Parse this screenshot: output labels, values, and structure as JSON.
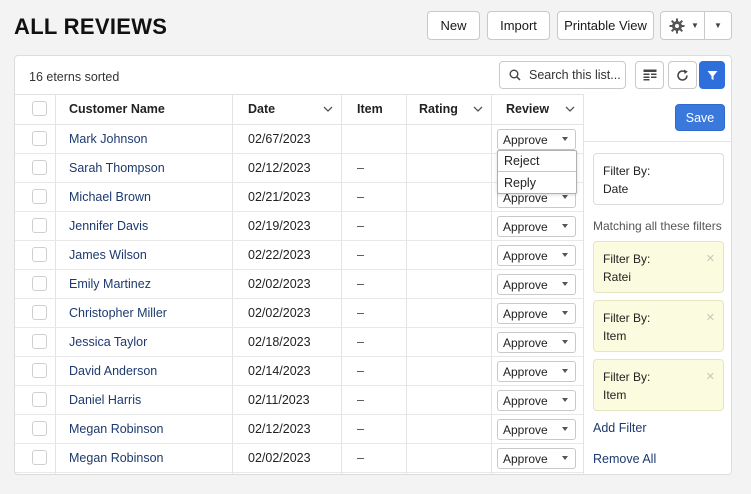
{
  "header": {
    "title": "ALL REVIEWS",
    "buttons": {
      "new": "New",
      "import": "Import",
      "printable": "Printable View"
    }
  },
  "list": {
    "sort_status": "16 eterns sorted",
    "search": {
      "placeholder": "Search this list..."
    },
    "columns": [
      "Customer Name",
      "Date",
      "Item",
      "Rating",
      "Review"
    ],
    "rows": [
      {
        "name": "Mark Johnson",
        "date": "02/67/2023",
        "item": "",
        "rating": "",
        "review": "Approve"
      },
      {
        "name": "Sarah Thompson",
        "date": "02/12/2023",
        "item": "–",
        "rating": "",
        "review": "Approve"
      },
      {
        "name": "Michael Brown",
        "date": "02/21/2023",
        "item": "–",
        "rating": "",
        "review": "Approve"
      },
      {
        "name": "Jennifer Davis",
        "date": "02/19/2023",
        "item": "–",
        "rating": "",
        "review": "Approve"
      },
      {
        "name": "James Wilson",
        "date": "02/22/2023",
        "item": "–",
        "rating": "",
        "review": "Approve"
      },
      {
        "name": "Emily Martinez",
        "date": "02/02/2023",
        "item": "–",
        "rating": "",
        "review": "Approve"
      },
      {
        "name": "Christopher Miller",
        "date": "02/02/2023",
        "item": "–",
        "rating": "",
        "review": "Approve"
      },
      {
        "name": "Jessica Taylor",
        "date": "02/18/2023",
        "item": "–",
        "rating": "",
        "review": "Approve"
      },
      {
        "name": "David Anderson",
        "date": "02/14/2023",
        "item": "–",
        "rating": "",
        "review": "Approve"
      },
      {
        "name": "Daniel Harris",
        "date": "02/11/2023",
        "item": "–",
        "rating": "",
        "review": "Approve"
      },
      {
        "name": "Megan Robinson",
        "date": "02/12/2023",
        "item": "–",
        "rating": "",
        "review": "Approve"
      },
      {
        "name": "Megan Robinson",
        "date": "02/02/2023",
        "item": "–",
        "rating": "",
        "review": "Approve"
      }
    ],
    "dropdown_options": [
      "Reject",
      "Reply"
    ]
  },
  "filter_panel": {
    "save": "Save",
    "current_filter": {
      "label": "Filter By:",
      "value": "Date"
    },
    "matching_title": "Matching all these filters",
    "filters": [
      {
        "label": "Filter By:",
        "value": "Ratei"
      },
      {
        "label": "Filter By:",
        "value": "Item"
      },
      {
        "label": "Filter By:",
        "value": "Item"
      }
    ],
    "add_filter": "Add Filter",
    "remove_all": "Remove All"
  },
  "colors": {
    "accent": "#2f6fdb",
    "link": "#1d3a6e",
    "filter_highlight": "#fbfbe0"
  },
  "icons": [
    "gear-icon",
    "chevron-down-icon",
    "search-icon",
    "table-view-icon",
    "refresh-icon",
    "filter-icon",
    "close-icon"
  ]
}
